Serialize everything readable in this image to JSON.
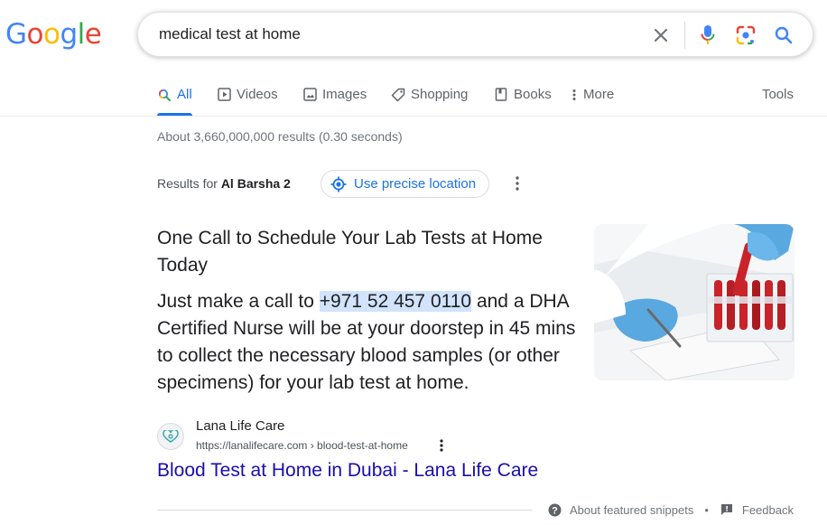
{
  "logo": {
    "g1": "G",
    "o1": "o",
    "o2": "o",
    "g2": "g",
    "l": "l",
    "e": "e"
  },
  "search": {
    "query": "medical test at home"
  },
  "tabs": [
    {
      "label": "All",
      "icon": "search-icon"
    },
    {
      "label": "Videos",
      "icon": "play-icon"
    },
    {
      "label": "Images",
      "icon": "image-icon"
    },
    {
      "label": "Shopping",
      "icon": "tag-icon"
    },
    {
      "label": "Books",
      "icon": "book-icon"
    },
    {
      "label": "More",
      "icon": "more-vert-icon"
    }
  ],
  "tools_label": "Tools",
  "stats": "About 3,660,000,000 results (0.30 seconds)",
  "location": {
    "prefix": "Results for",
    "place": "Al Barsha 2",
    "button_label": "Use precise location"
  },
  "snippet": {
    "title": "One Call to Schedule Your Lab Tests at Home Today",
    "body_before": "Just make a call to ",
    "phone": "+971 52 457 0110",
    "body_after": " and a DHA Certified Nurse will be at your doorstep in 45 mins to collect the necessary blood samples (or other specimens) for your lab test at home."
  },
  "source": {
    "site_name": "Lana Life Care",
    "url": "https://lanalifecare.com › blood-test-at-home",
    "link_title": "Blood Test at Home in Dubai - Lana Life Care"
  },
  "footer": {
    "about_label": "About featured snippets",
    "separator": "•",
    "feedback_label": "Feedback"
  },
  "colors": {
    "accent": "#1a73e8",
    "link": "#1a0dab",
    "highlight": "#d2e3fc"
  }
}
